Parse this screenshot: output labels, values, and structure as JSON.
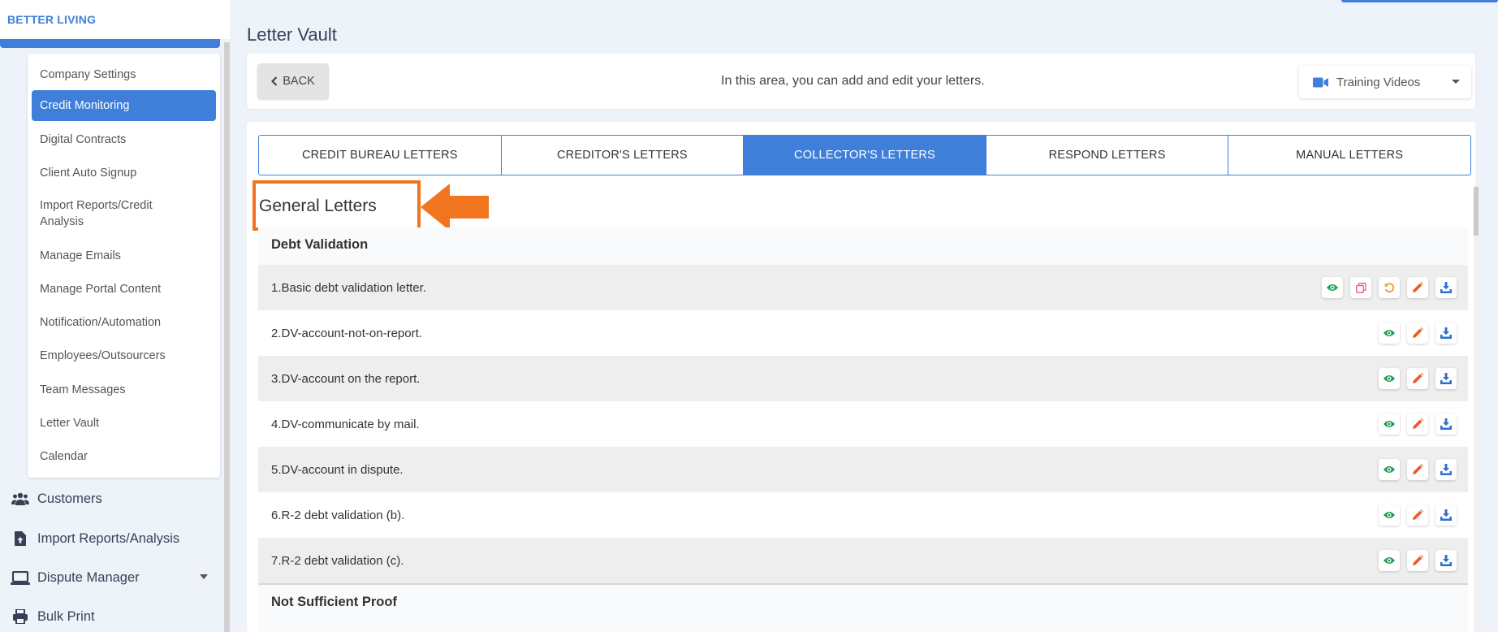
{
  "brand": "BETTER LIVING",
  "sidebar": {
    "submenu": [
      "Company Settings",
      "Credit Monitoring",
      "Digital Contracts",
      "Client Auto Signup",
      "Import Reports/Credit Analysis",
      "Manage Emails",
      "Manage Portal Content",
      "Notification/Automation",
      "Employees/Outsourcers",
      "Team Messages",
      "Letter Vault",
      "Calendar"
    ],
    "active_submenu": "Credit Monitoring",
    "nav": [
      {
        "label": "Customers",
        "icon": "users-icon"
      },
      {
        "label": "Import Reports/Analysis",
        "icon": "file-upload-icon"
      },
      {
        "label": "Dispute Manager",
        "icon": "laptop-icon"
      },
      {
        "label": "Bulk Print",
        "icon": "printer-icon"
      }
    ]
  },
  "page_title": "Letter Vault",
  "header": {
    "back_label": "BACK",
    "message": "In this area, you can add and edit your letters.",
    "training_label": "Training Videos"
  },
  "tabs": [
    "CREDIT BUREAU LETTERS",
    "CREDITOR'S LETTERS",
    "COLLECTOR'S LETTERS",
    "RESPOND LETTERS",
    "MANUAL LETTERS"
  ],
  "active_tab": "COLLECTOR'S LETTERS",
  "section_title": "General Letters",
  "groups": [
    {
      "title": "Debt Validation",
      "letters": [
        {
          "name": "1.Basic debt validation letter.",
          "actions": [
            "view",
            "copy",
            "restore",
            "edit",
            "download"
          ]
        },
        {
          "name": "2.DV-account-not-on-report.",
          "actions": [
            "view",
            "edit",
            "download"
          ]
        },
        {
          "name": "3.DV-account on the report.",
          "actions": [
            "view",
            "edit",
            "download"
          ]
        },
        {
          "name": "4.DV-communicate by mail.",
          "actions": [
            "view",
            "edit",
            "download"
          ]
        },
        {
          "name": "5.DV-account in dispute.",
          "actions": [
            "view",
            "edit",
            "download"
          ]
        },
        {
          "name": "6.R-2 debt validation (b).",
          "actions": [
            "view",
            "edit",
            "download"
          ]
        },
        {
          "name": "7.R-2 debt validation (c).",
          "actions": [
            "view",
            "edit",
            "download"
          ]
        }
      ]
    },
    {
      "title": "Not Sufficient Proof",
      "letters": []
    }
  ],
  "colors": {
    "accent": "#3f7fd9",
    "highlight": "#f0751e",
    "view": "#1e9e57",
    "copy": "#e9629a",
    "restore": "#f29c1f",
    "edit": "#ee5a24",
    "download": "#2f6fd1"
  }
}
